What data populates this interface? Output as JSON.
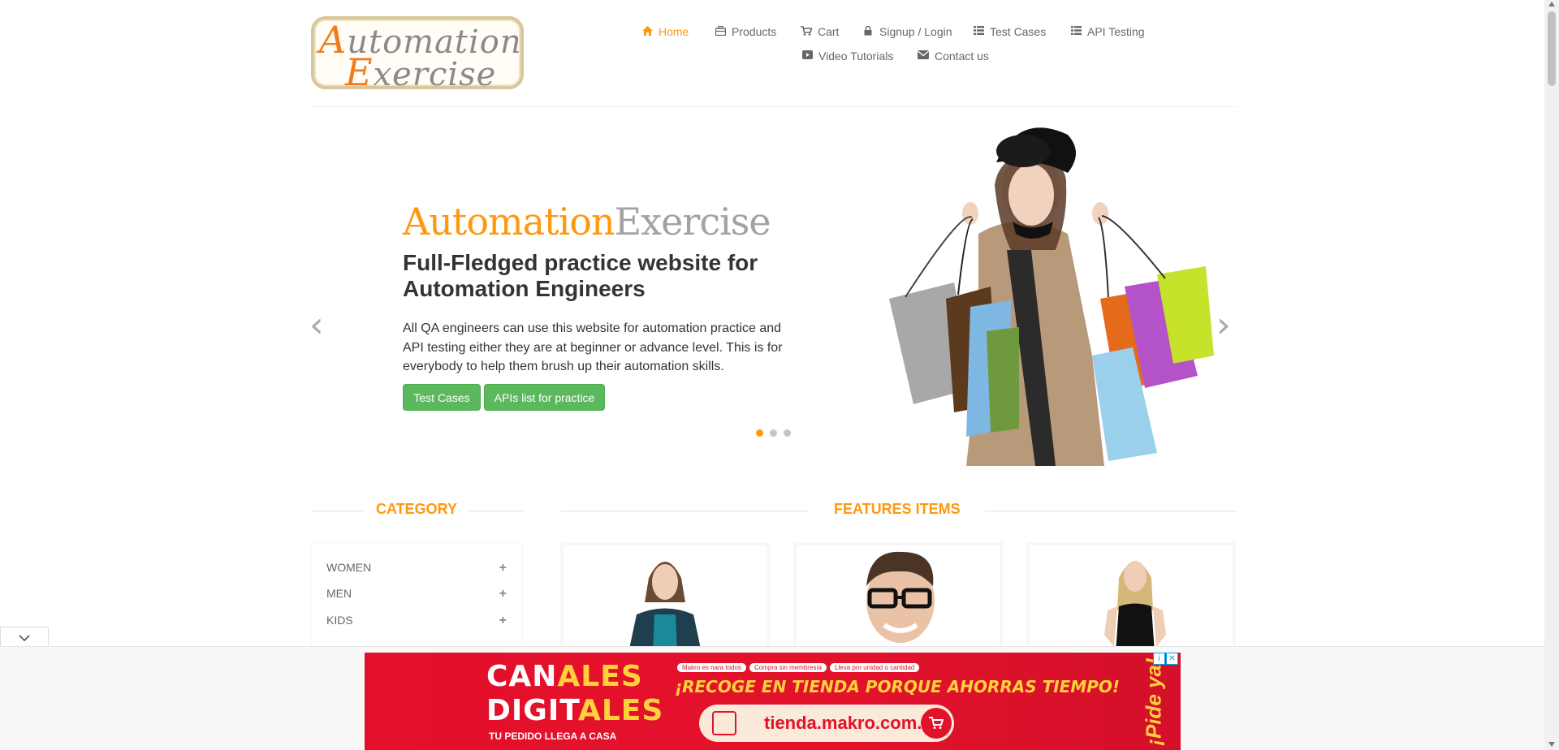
{
  "logo": {
    "line1_cap": "A",
    "line1_rest": "utomation",
    "line2_cap": "E",
    "line2_rest": "xercise"
  },
  "nav": {
    "items": [
      {
        "label": "Home",
        "icon": "home-icon",
        "active": true
      },
      {
        "label": "Products",
        "icon": "products-icon"
      },
      {
        "label": "Cart",
        "icon": "cart-icon"
      },
      {
        "label": "Signup / Login",
        "icon": "lock-icon"
      },
      {
        "label": "Test Cases",
        "icon": "list-icon"
      },
      {
        "label": "API Testing",
        "icon": "list-icon"
      },
      {
        "label": "Video Tutorials",
        "icon": "youtube-icon"
      },
      {
        "label": "Contact us",
        "icon": "envelope-icon"
      }
    ]
  },
  "slider": {
    "brand_orange": "Automation",
    "brand_gray": "Exercise",
    "headline": "Full-Fledged practice website for Automation Engineers",
    "description": "All QA engineers can use this website for automation practice and API testing either they are at beginner or advance level. This is for everybody to help them brush up their automation skills.",
    "buttons": [
      "Test Cases",
      "APIs list for practice"
    ],
    "active_slide": 1,
    "slide_count": 3
  },
  "category": {
    "title": "CATEGORY",
    "items": [
      "WOMEN",
      "MEN",
      "KIDS"
    ]
  },
  "features": {
    "title": "FEATURES ITEMS"
  },
  "ad": {
    "line1_white": "CAN",
    "line1_yellow": "ALES",
    "line2_white": "DIGIT",
    "line2_yellow": "ALES",
    "sub": "TU PEDIDO LLEGA A CASA",
    "pills": [
      "Makro es nara todos",
      "Compra sin membresía",
      "Lleva por unidad o cantidad"
    ],
    "tagline": "¡RECOGE EN TIENDA PORQUE AHORRAS TIEMPO!",
    "url": "tienda.makro.com.co",
    "vertical": "¡Pide ya!"
  },
  "colors": {
    "accent": "#fe980f",
    "button_green": "#5cb85c",
    "ad_red": "#e2122b",
    "ad_yellow": "#ffd23c"
  }
}
